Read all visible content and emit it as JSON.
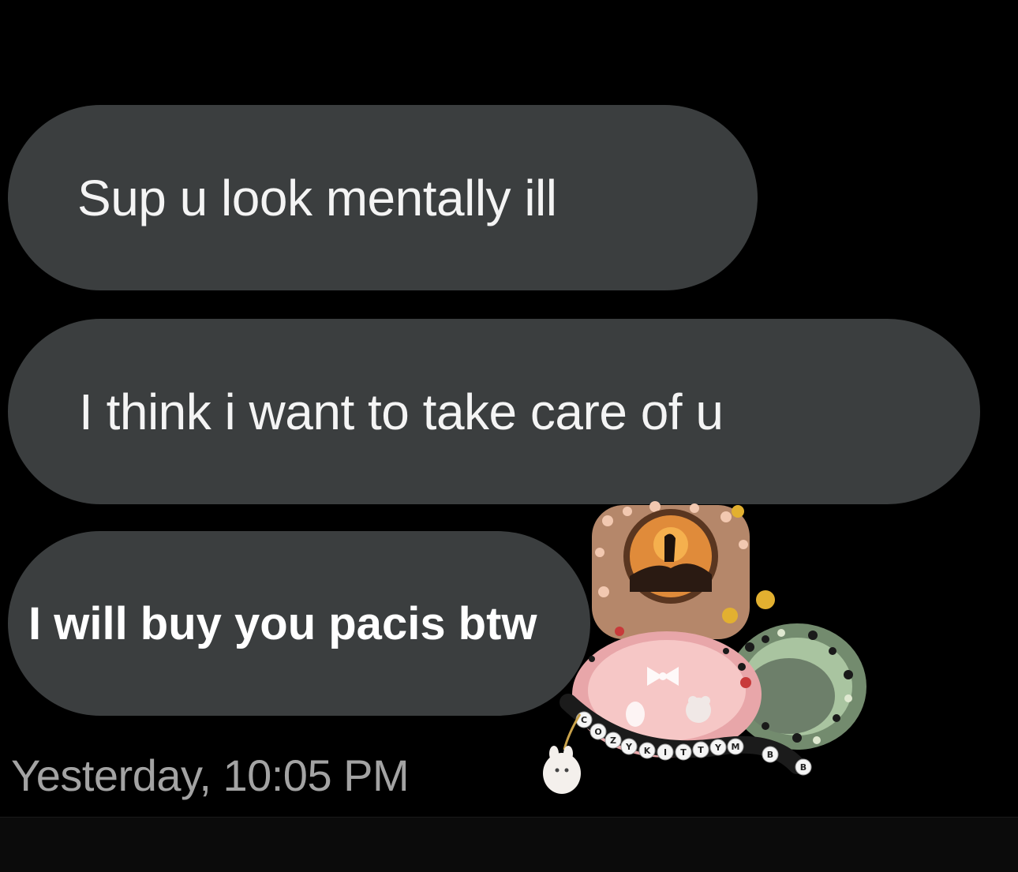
{
  "messages": [
    {
      "text": "Sup u look mentally ill"
    },
    {
      "text": "I think i want to take care of u"
    },
    {
      "text": "I will buy you pacis btw"
    }
  ],
  "timestamp": "Yesterday, 10:05 PM",
  "sticker": {
    "icon": "pacifier-sticker-icon",
    "bead_letters": [
      "C",
      "O",
      "Z",
      "Y",
      "K",
      "I",
      "T",
      "T",
      "Y",
      "M",
      "B",
      "B"
    ]
  },
  "colors": {
    "background": "#000000",
    "bubble": "#3b3e3f",
    "message_text": "#f4f4f4",
    "timestamp_text": "#a3a3a3"
  }
}
